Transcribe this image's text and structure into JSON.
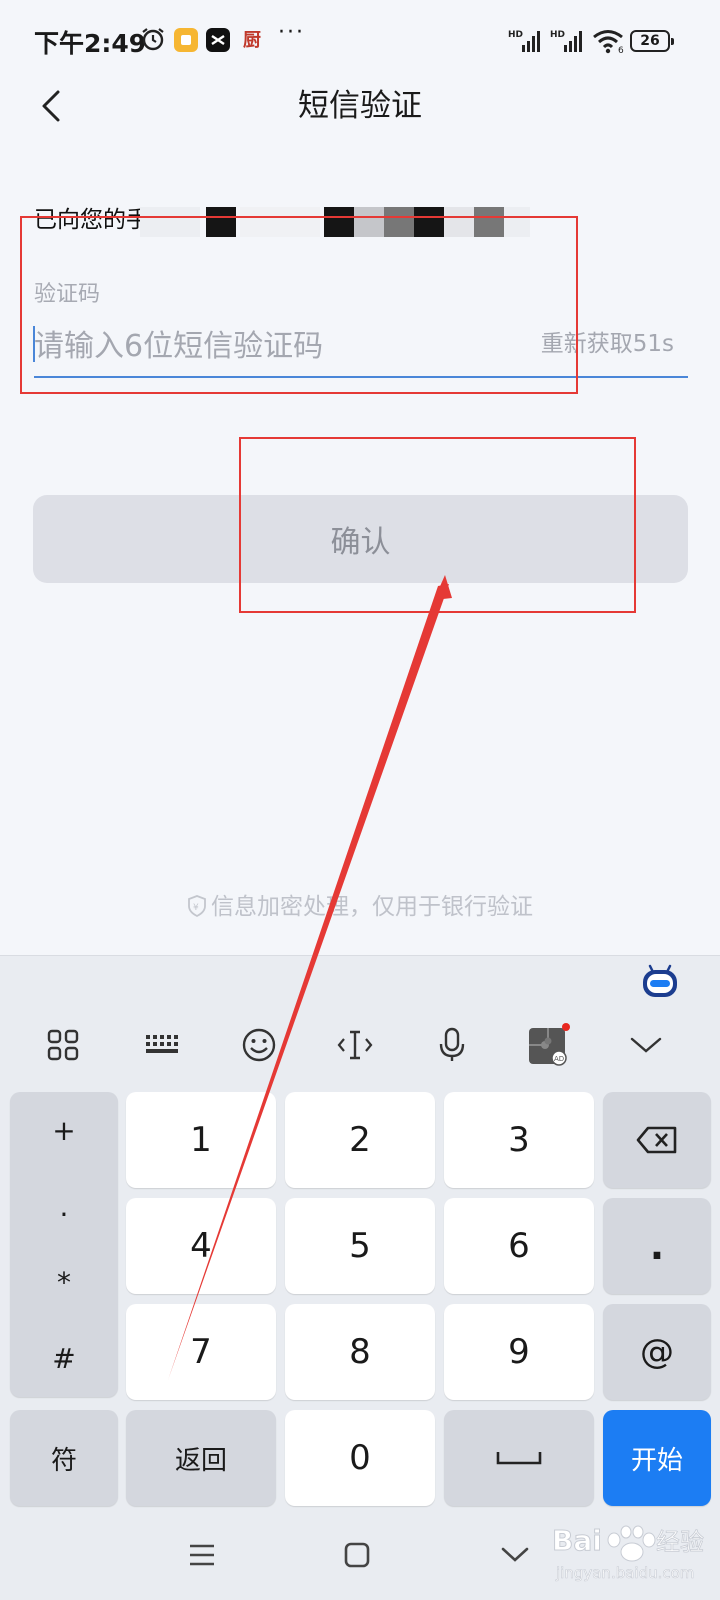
{
  "status_bar": {
    "time": "下午2:49",
    "kitchen_glyph": "厨",
    "more": "···",
    "network_type": "HD",
    "battery": "26"
  },
  "header": {
    "title": "短信验证",
    "back_icon": "chevron-left-icon"
  },
  "sms_info": {
    "text": "已向您的手"
  },
  "code_field": {
    "label": "验证码",
    "placeholder": "请输入6位短信验证码",
    "value": "",
    "resend": "重新获取51s"
  },
  "confirm_button": {
    "label": "确认",
    "enabled": false
  },
  "security_note": {
    "text": "信息加密处理，仅用于银行验证"
  },
  "keyboard": {
    "toolbar": [
      "grid-icon",
      "keyboard-icon",
      "emoji-icon",
      "cursor-icon",
      "microphone-icon",
      "puzzle-ad-icon",
      "collapse-chevron-icon"
    ],
    "symbols": [
      "+",
      ".",
      "*",
      "#"
    ],
    "digits": [
      "1",
      "2",
      "3",
      "4",
      "5",
      "6",
      "7",
      "8",
      "9",
      "0"
    ],
    "dot": ".",
    "at": "@",
    "fu": "符",
    "back": "返回",
    "start": "开始"
  },
  "nav_bar": [
    "menu-icon",
    "home-square-icon",
    "back-chevron-icon"
  ],
  "watermark": {
    "brand": "Bai",
    "suffix": "经验",
    "url": "jingyan.baidu.com"
  },
  "colors": {
    "accent": "#1c7df3",
    "annotation": "#e53935",
    "underline": "#4a86d8"
  }
}
